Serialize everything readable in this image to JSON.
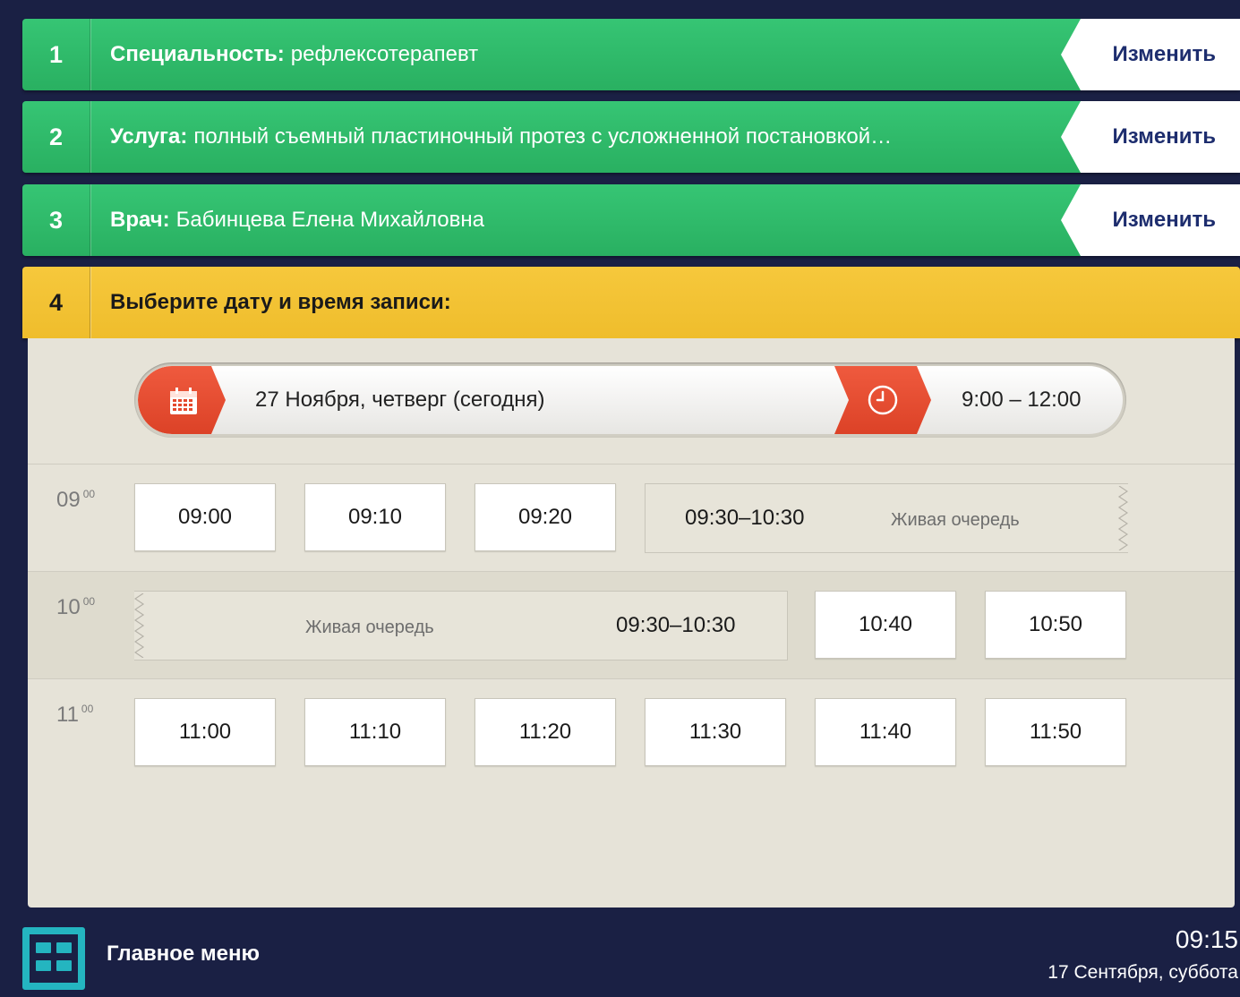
{
  "steps": [
    {
      "num": "1",
      "label": "Специальность:",
      "value": "рефлексотерапевт",
      "change": "Изменить"
    },
    {
      "num": "2",
      "label": "Услуга:",
      "value": "полный съемный пластиночный протез с усложненной постановкой…",
      "change": "Изменить"
    },
    {
      "num": "3",
      "label": "Врач:",
      "value": "Бабинцева Елена Михайловна",
      "change": "Изменить"
    },
    {
      "num": "4",
      "title": "Выберите дату и время записи:"
    }
  ],
  "selector": {
    "date": "27 Ноября, четверг (сегодня)",
    "time_range": "9:00 – 12:00",
    "date_icon": "calendar-icon",
    "time_icon": "clock-icon"
  },
  "schedule": {
    "rows": [
      {
        "hour": "09",
        "minutes": "00",
        "slots": [
          "09:00",
          "09:10",
          "09:20"
        ],
        "queue": {
          "range": "09:30–10:30",
          "label": "Живая очередь"
        }
      },
      {
        "hour": "10",
        "minutes": "00",
        "queue": {
          "range": "09:30–10:30",
          "label": "Живая очередь"
        },
        "slots": [
          "10:40",
          "10:50"
        ]
      },
      {
        "hour": "11",
        "minutes": "00",
        "slots": [
          "11:00",
          "11:10",
          "11:20",
          "11:30",
          "11:40",
          "11:50"
        ]
      }
    ]
  },
  "footer": {
    "menu_label": "Главное меню",
    "menu_icon": "grid-menu-icon",
    "time": "09:15",
    "date": "17 Сентября, суббота"
  },
  "colors": {
    "background": "#1a2044",
    "step_done": "#2fba68",
    "step_active": "#f2c232",
    "accent_red": "#e5492d",
    "menu_icon": "#24b5c0",
    "change_text": "#1d2d6e"
  }
}
